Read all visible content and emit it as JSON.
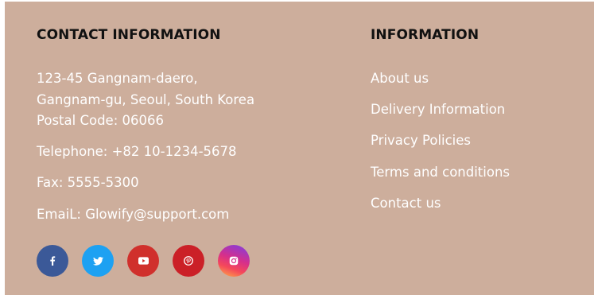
{
  "contact": {
    "heading": "CONTACT INFORMATION",
    "address_line1": "123-45 Gangnam-daero,",
    "address_line2": "Gangnam-gu, Seoul, South Korea",
    "postal": "Postal Code: 06066",
    "telephone": "Telephone: +82 10-1234-5678",
    "fax": "Fax: 5555-5300",
    "email": "EmaiL: Glowify@support.com"
  },
  "information": {
    "heading": "INFORMATION",
    "links": [
      "About us",
      "Delivery Information",
      "Privacy Policies",
      "Terms and conditions",
      "Contact us"
    ]
  },
  "socials": [
    {
      "icon": "facebook-icon",
      "color": "#3b5998"
    },
    {
      "icon": "twitter-icon",
      "color": "#1da1f2"
    },
    {
      "icon": "youtube-icon",
      "color": "#d0302c"
    },
    {
      "icon": "pinterest-icon",
      "color": "#cb2027"
    },
    {
      "icon": "instagram-icon",
      "color": "gradient"
    }
  ],
  "colors": {
    "footer_bg": "#cdae9c",
    "heading": "#111111",
    "text": "#ffffff"
  }
}
